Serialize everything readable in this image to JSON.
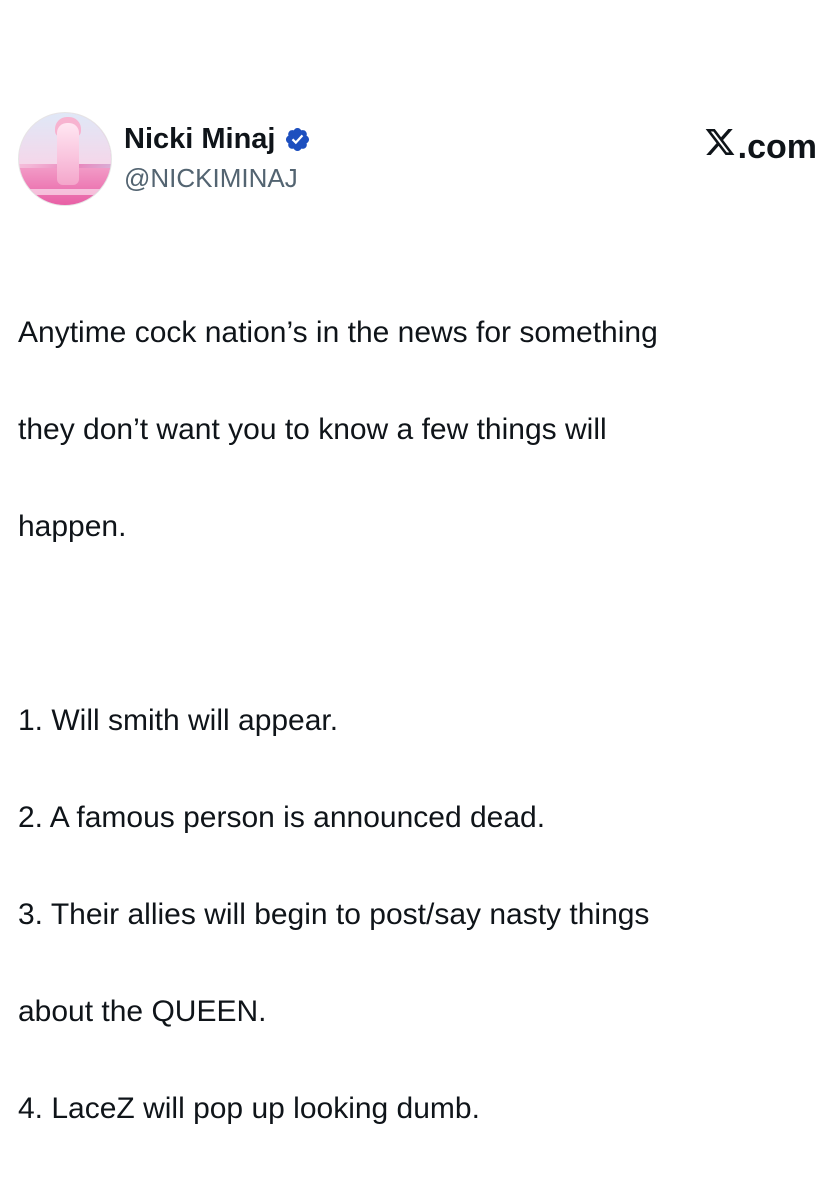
{
  "author": {
    "display_name": "Nicki Minaj",
    "handle": "@NICKIMINAJ",
    "verified": true,
    "verified_color": "#1d4fbf"
  },
  "brand": {
    "label": ".com",
    "logo_icon": "x-logo-icon"
  },
  "tweet": {
    "intro_lines": [
      "Anytime cock nation’s in the news for something",
      "they don’t want you to know a few things will",
      "happen."
    ],
    "list_lines": [
      "1. Will smith will appear.",
      "2. A famous person is announced dead.",
      "3. Their allies will begin to post/say nasty things",
      "about the QUEEN.",
      "4. LaceZ will pop up looking dumb."
    ]
  }
}
